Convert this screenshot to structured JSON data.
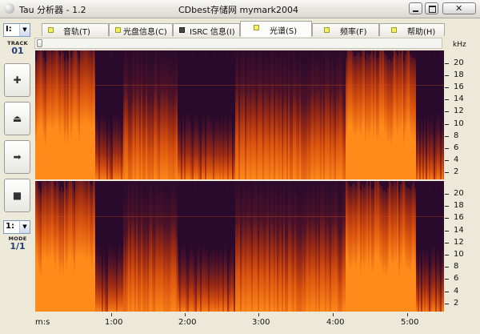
{
  "window": {
    "app_title": "Tau 分析器 - 1.2",
    "doc_title": "CDbest存储网 mymark2004"
  },
  "left": {
    "drive": "I:",
    "track_label": "TRACK",
    "track_value": "01",
    "mode_combo": "1:",
    "mode_label": "MODE",
    "mode_value": "1/1",
    "buttons": [
      {
        "name": "add",
        "glyph": "✚"
      },
      {
        "name": "eject",
        "glyph": "⏏"
      },
      {
        "name": "play",
        "glyph": "➡"
      },
      {
        "name": "stop",
        "glyph": "■"
      }
    ]
  },
  "tabs": [
    {
      "label": "音轨(T)",
      "check": "yellow"
    },
    {
      "label": "光盘信息(C)",
      "check": "yellow"
    },
    {
      "label": "ISRC 信息(I)",
      "check": "dark"
    },
    {
      "label": "光谱(S)",
      "check": "yellow",
      "active": true
    },
    {
      "label": "频率(F)",
      "check": "yellow"
    },
    {
      "label": "帮助(H)",
      "check": "yellow"
    }
  ],
  "freq_unit": "kHz",
  "freq_labels": [
    "20",
    "18",
    "16",
    "14",
    "12",
    "10",
    "8",
    "6",
    "4",
    "2"
  ],
  "time_axis": {
    "unit": "m:s",
    "labels": [
      "1:00",
      "2:00",
      "3:00",
      "4:00",
      "5:00"
    ]
  },
  "colors": {
    "hot": "#ff8c1a",
    "warm": "#d9520f",
    "mid": "#9a2a14",
    "cool": "#4e1228",
    "cold": "#2a0a2c"
  }
}
